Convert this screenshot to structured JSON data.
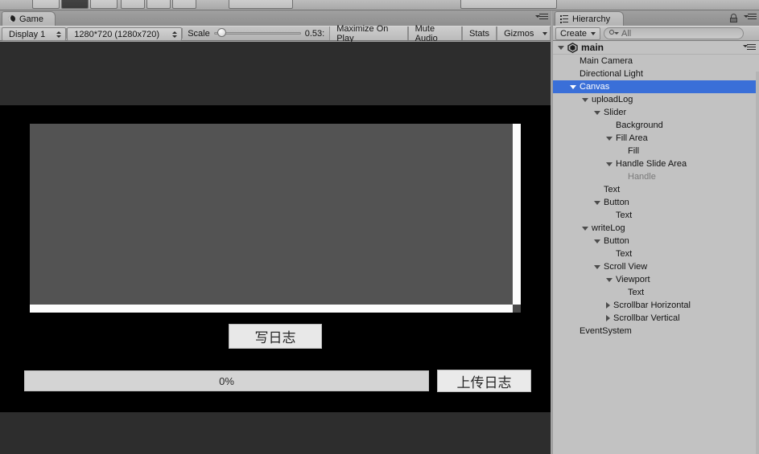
{
  "window": {
    "background_color": "#9a9a9a"
  },
  "top_toolbar": {
    "visible_partial": true
  },
  "game_panel": {
    "tab": {
      "label": "Game",
      "icon": "unity-game-moon-icon"
    },
    "panel_menu_icon": "panel-options-icon",
    "toolbar": {
      "display_dropdown": {
        "label": "Display 1",
        "options": [
          "Display 1"
        ]
      },
      "resolution_dropdown": {
        "label": "1280*720 (1280x720)",
        "options": [
          "1280*720 (1280x720)"
        ]
      },
      "scale_label": "Scale",
      "scale_value": "0.53:",
      "scale_slider_percent": 4,
      "maximize_on_play": "Maximize On Play",
      "mute_audio": "Mute Audio",
      "stats": "Stats",
      "gizmos": "Gizmos"
    },
    "game_ui": {
      "scroll_view": {
        "content_text": "",
        "vertical_scrollbar": "scrollbar-vertical",
        "horizontal_scrollbar": "scrollbar-horizontal"
      },
      "write_log_button": "写日志",
      "progress_slider": {
        "label": "0%",
        "value_percent": 0
      },
      "upload_log_button": "上传日志"
    },
    "colors": {
      "game_background": "#000000",
      "scrollview_background": "#535353",
      "button_face": "#e8e8e8",
      "slider_background": "#d4d4d4"
    }
  },
  "hierarchy_panel": {
    "tab": {
      "label": "Hierarchy",
      "icon": "hierarchy-list-icon"
    },
    "lock_icon": "lock-open-icon",
    "panel_menu_icon": "panel-options-icon",
    "toolbar": {
      "create_button": "Create",
      "search_placeholder": "All",
      "search_value": "",
      "search_icon": "search-icon"
    },
    "selection_color": "#3a6fd8",
    "root": {
      "label": "main",
      "icon": "unity-scene-icon",
      "expanded": true
    },
    "tree": [
      {
        "label": "Main Camera",
        "depth": 1,
        "toggle": "none",
        "selected": false,
        "dim": false
      },
      {
        "label": "Directional Light",
        "depth": 1,
        "toggle": "none",
        "selected": false,
        "dim": false
      },
      {
        "label": "Canvas",
        "depth": 1,
        "toggle": "expanded",
        "selected": true,
        "dim": false
      },
      {
        "label": "uploadLog",
        "depth": 2,
        "toggle": "expanded",
        "selected": false,
        "dim": false
      },
      {
        "label": "Slider",
        "depth": 3,
        "toggle": "expanded",
        "selected": false,
        "dim": false
      },
      {
        "label": "Background",
        "depth": 4,
        "toggle": "none",
        "selected": false,
        "dim": false
      },
      {
        "label": "Fill Area",
        "depth": 4,
        "toggle": "expanded",
        "selected": false,
        "dim": false
      },
      {
        "label": "Fill",
        "depth": 5,
        "toggle": "none",
        "selected": false,
        "dim": false
      },
      {
        "label": "Handle Slide Area",
        "depth": 4,
        "toggle": "expanded",
        "selected": false,
        "dim": false
      },
      {
        "label": "Handle",
        "depth": 5,
        "toggle": "none",
        "selected": false,
        "dim": true
      },
      {
        "label": "Text",
        "depth": 3,
        "toggle": "none",
        "selected": false,
        "dim": false
      },
      {
        "label": "Button",
        "depth": 3,
        "toggle": "expanded",
        "selected": false,
        "dim": false
      },
      {
        "label": "Text",
        "depth": 4,
        "toggle": "none",
        "selected": false,
        "dim": false
      },
      {
        "label": "writeLog",
        "depth": 2,
        "toggle": "expanded",
        "selected": false,
        "dim": false
      },
      {
        "label": "Button",
        "depth": 3,
        "toggle": "expanded",
        "selected": false,
        "dim": false
      },
      {
        "label": "Text",
        "depth": 4,
        "toggle": "none",
        "selected": false,
        "dim": false
      },
      {
        "label": "Scroll View",
        "depth": 3,
        "toggle": "expanded",
        "selected": false,
        "dim": false
      },
      {
        "label": "Viewport",
        "depth": 4,
        "toggle": "expanded",
        "selected": false,
        "dim": false
      },
      {
        "label": "Text",
        "depth": 5,
        "toggle": "none",
        "selected": false,
        "dim": false
      },
      {
        "label": "Scrollbar Horizontal",
        "depth": 4,
        "toggle": "collapsed",
        "selected": false,
        "dim": false
      },
      {
        "label": "Scrollbar Vertical",
        "depth": 4,
        "toggle": "collapsed",
        "selected": false,
        "dim": false
      },
      {
        "label": "EventSystem",
        "depth": 1,
        "toggle": "none",
        "selected": false,
        "dim": false
      }
    ]
  }
}
